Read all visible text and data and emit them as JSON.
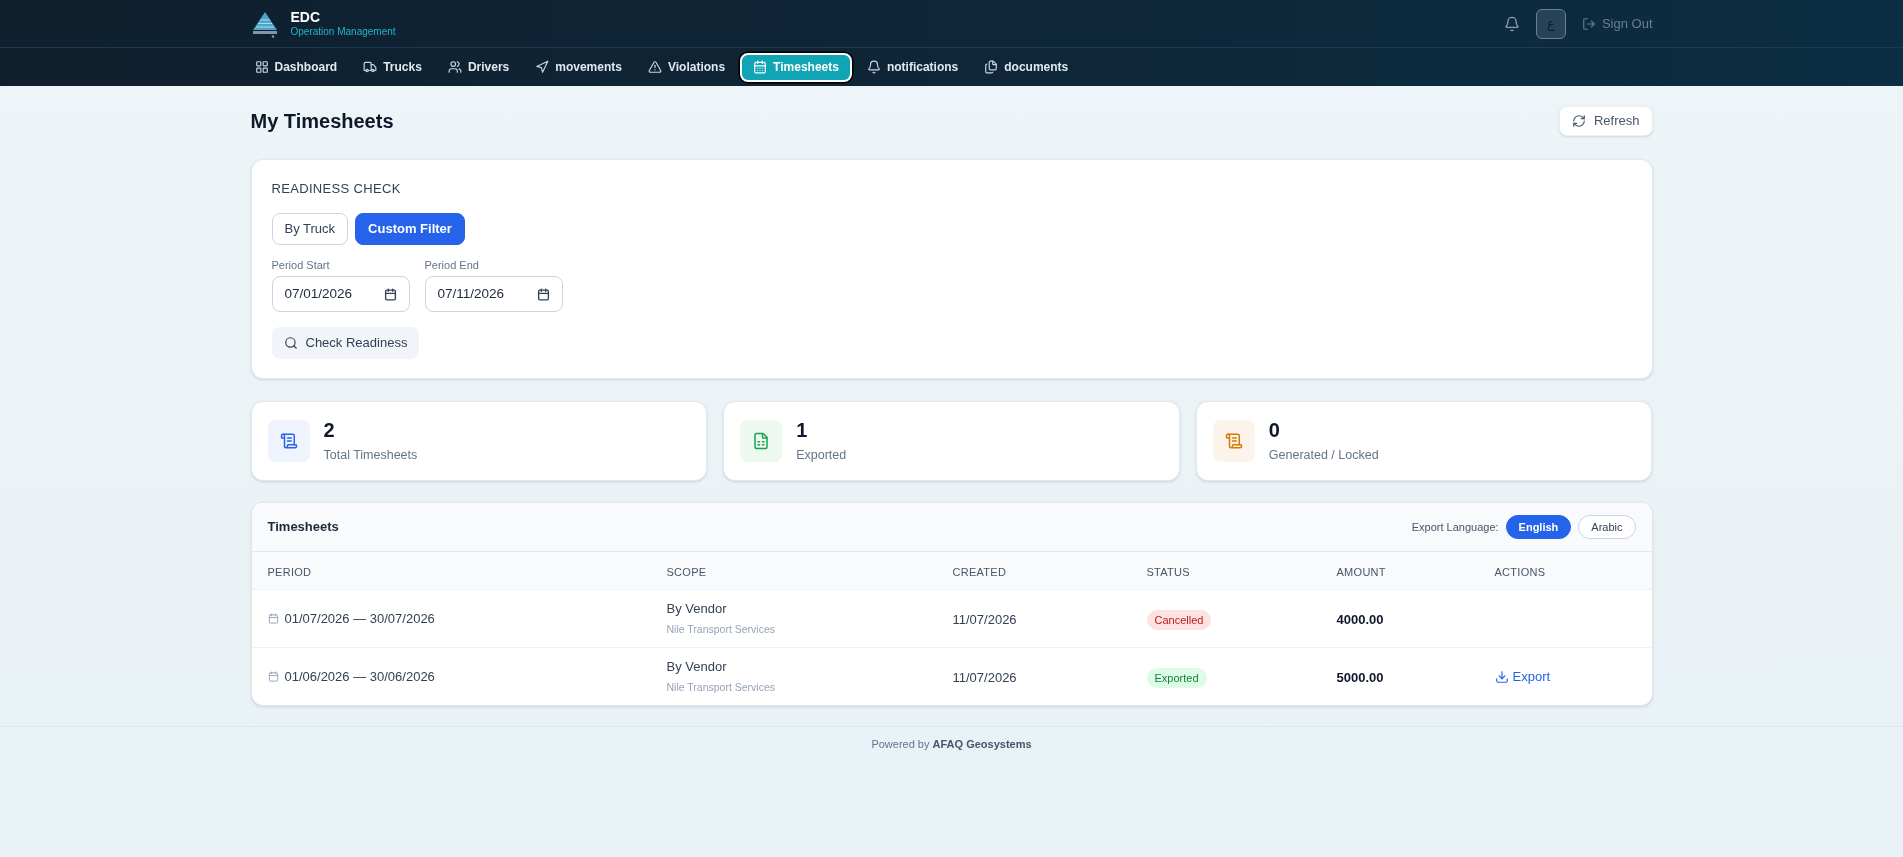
{
  "header": {
    "brand": "EDC",
    "subtitle": "Operation Management",
    "avatar": "ع",
    "sign_out": "Sign Out"
  },
  "nav": [
    {
      "label": "Dashboard",
      "selected": false
    },
    {
      "label": "Trucks",
      "selected": false
    },
    {
      "label": "Drivers",
      "selected": false
    },
    {
      "label": "movements",
      "selected": false
    },
    {
      "label": "Violations",
      "selected": false
    },
    {
      "label": "Timesheets",
      "selected": true
    },
    {
      "label": "notifications",
      "selected": false
    },
    {
      "label": "documents",
      "selected": false
    }
  ],
  "page": {
    "title": "My Timesheets",
    "refresh": "Refresh"
  },
  "readiness": {
    "heading": "READINESS CHECK",
    "modes": [
      {
        "label": "By Truck",
        "selected": false
      },
      {
        "label": "Custom Filter",
        "selected": true
      }
    ],
    "fields": [
      {
        "label": "Period Start",
        "value": "07/01/2026"
      },
      {
        "label": "Period End",
        "value": "07/11/2026"
      }
    ],
    "check_button": "Check Readiness"
  },
  "stats": [
    {
      "value": "2",
      "label": "Total Timesheets",
      "color": "#2563eb"
    },
    {
      "value": "1",
      "label": "Exported",
      "color": "#16a34a"
    },
    {
      "value": "0",
      "label": "Generated / Locked",
      "color": "#d97706"
    }
  ],
  "table": {
    "title": "Timesheets",
    "export_language": {
      "label": "Export Language:",
      "options": [
        {
          "label": "English",
          "selected": true
        },
        {
          "label": "Arabic",
          "selected": false
        }
      ]
    },
    "columns": [
      "PERIOD",
      "SCOPE",
      "CREATED",
      "STATUS",
      "AMOUNT",
      "ACTIONS"
    ],
    "rows": [
      {
        "period": "01/07/2026 — 30/07/2026",
        "scope": "By Vendor",
        "vendor": "Nile Transport Services",
        "created": "11/07/2026",
        "status": {
          "label": "Cancelled",
          "kind": "cancelled"
        },
        "amount": "4000.00"
      },
      {
        "period": "01/06/2026 — 30/06/2026",
        "scope": "By Vendor",
        "vendor": "Nile Transport Services",
        "created": "11/07/2026",
        "status": {
          "label": "Exported",
          "kind": "exported"
        },
        "amount": "5000.00",
        "action": "Export"
      }
    ]
  },
  "footer": "Powered by **AFAQ Geosystems**"
}
